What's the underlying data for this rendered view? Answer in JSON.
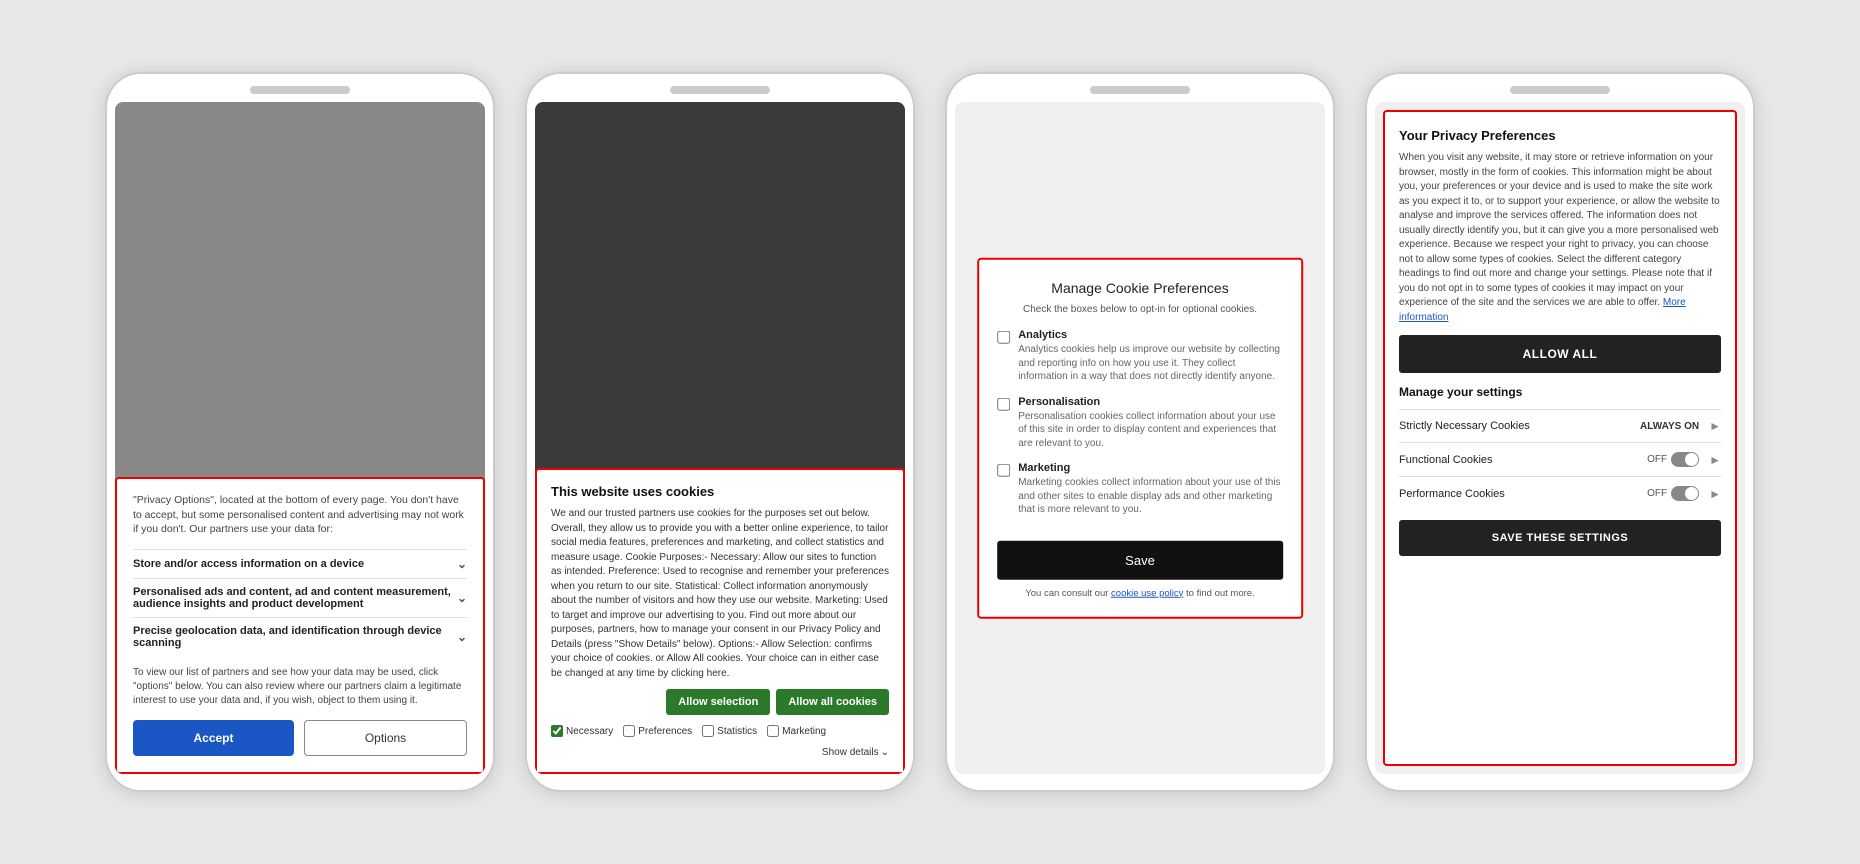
{
  "phone1": {
    "intro_text": "\"Privacy Options\", located at the bottom of every page. You don't have to accept, but some personalised content and advertising may not work if you don't. Our partners use your data for:",
    "options": [
      {
        "title": "Store and/or access information on a device",
        "desc": ""
      },
      {
        "title": "Personalised ads and content, ad and content measurement, audience insights and product development",
        "desc": ""
      },
      {
        "title": "Precise geolocation data, and identification through device scanning",
        "desc": ""
      }
    ],
    "note": "To view our list of partners and see how your data may be used, click \"options\" below. You can also review where our partners claim a legitimate interest to use your data and, if you wish, object to them using it.",
    "accept_label": "Accept",
    "options_label": "Options"
  },
  "phone2": {
    "title": "This website uses cookies",
    "body": "We and our trusted partners use cookies for the purposes set out below. Overall, they allow us to provide you with a better online experience, to tailor social media features, preferences and marketing, and collect statistics and measure usage. Cookie Purposes:- Necessary: Allow our sites to function as intended. Preference: Used to recognise and remember your preferences when you return to our site. Statistical: Collect information anonymously about the number of visitors and how they use our website. Marketing: Used to target and improve our advertising to you. Find out more about our purposes, partners, how to manage your consent in our Privacy Policy and Details (press \"Show Details\" below). Options:- Allow Selection: confirms your choice of cookies. or Allow All cookies. Your choice can in either case be changed at any time by clicking here.",
    "allow_selection_label": "Allow selection",
    "allow_all_label": "Allow all cookies",
    "checkboxes": [
      {
        "label": "Necessary",
        "checked": true
      },
      {
        "label": "Preferences",
        "checked": false
      },
      {
        "label": "Statistics",
        "checked": false
      },
      {
        "label": "Marketing",
        "checked": false
      }
    ],
    "show_details_label": "Show details"
  },
  "phone3": {
    "title": "Manage Cookie Preferences",
    "subtitle": "Check the boxes below to opt-in for optional cookies.",
    "cookies": [
      {
        "label": "Analytics",
        "desc": "Analytics cookies help us improve our website by collecting and reporting info on how you use it. They collect information in a way that does not directly identify anyone.",
        "checked": false
      },
      {
        "label": "Personalisation",
        "desc": "Personalisation cookies collect information about your use of this site in order to display content and experiences that are relevant to you.",
        "checked": false
      },
      {
        "label": "Marketing",
        "desc": "Marketing cookies collect information about your use of this and other sites to enable display ads and other marketing that is more relevant to you.",
        "checked": false
      }
    ],
    "save_label": "Save",
    "consult_text": "You can consult our",
    "policy_link": "cookie use policy",
    "consult_suffix": "to find out more."
  },
  "phone4": {
    "title": "Your Privacy Preferences",
    "body": "When you visit any website, it may store or retrieve information on your browser, mostly in the form of cookies. This information might be about you, your preferences or your device and is used to make the site work as you expect it to, or to support your experience, or allow the website to analyse and improve the services offered. The information does not usually directly identify you, but it can give you a more personalised web experience. Because we respect your right to privacy, you can choose not to allow some types of cookies. Select the different category headings to find out more and change your settings. Please note that if you do not opt in to some types of cookies it may impact on your experience of the site and the services we are able to offer.",
    "more_info_link": "More information",
    "allow_all_label": "ALLOW ALL",
    "manage_settings_title": "Manage your settings",
    "settings": [
      {
        "label": "Strictly Necessary Cookies",
        "status": "ALWAYS ON",
        "type": "always_on"
      },
      {
        "label": "Functional Cookies",
        "status": "OFF",
        "type": "toggle"
      },
      {
        "label": "Performance Cookies",
        "status": "OFF",
        "type": "toggle"
      }
    ],
    "save_settings_label": "SAVE THESE SETTINGS"
  }
}
